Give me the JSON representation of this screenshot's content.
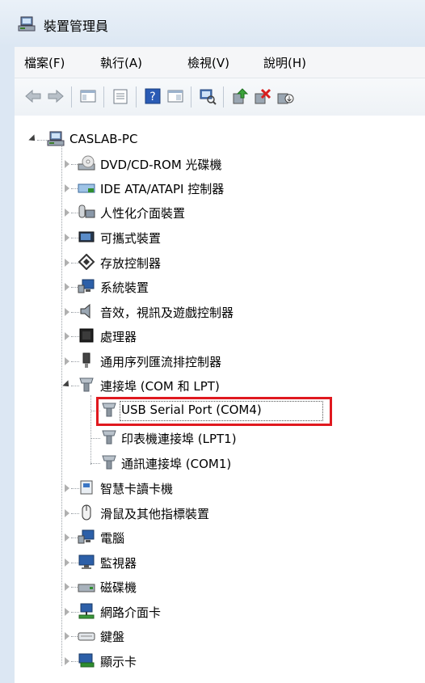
{
  "window": {
    "title": "裝置管理員"
  },
  "menu": [
    "檔案(F)",
    "執行(A)",
    "檢視(V)",
    "說明(H)"
  ],
  "toolbar": {
    "buttons": [
      "back-icon",
      "forward-icon",
      "show-hide-tree-icon",
      "properties-icon",
      "help-icon",
      "view-icon",
      "scan-hardware-icon",
      "update-driver-icon",
      "uninstall-icon",
      "disable-icon"
    ]
  },
  "tree": {
    "root": "CASLAB-PC",
    "items": [
      "DVD/CD-ROM 光碟機",
      "IDE ATA/ATAPI 控制器",
      "人性化介面裝置",
      "可攜式裝置",
      "存放控制器",
      "系統裝置",
      "音效，視訊及遊戲控制器",
      "處理器",
      "通用序列匯流排控制器",
      "連接埠 (COM 和 LPT)",
      "智慧卡讀卡機",
      "滑鼠及其他指標裝置",
      "電腦",
      "監視器",
      "磁碟機",
      "網路介面卡",
      "鍵盤",
      "顯示卡"
    ],
    "ports": [
      "USB Serial Port (COM4)",
      "印表機連接埠 (LPT1)",
      "通訊連接埠 (COM1)"
    ]
  },
  "colors": {
    "highlight_border": "#e0191f"
  }
}
